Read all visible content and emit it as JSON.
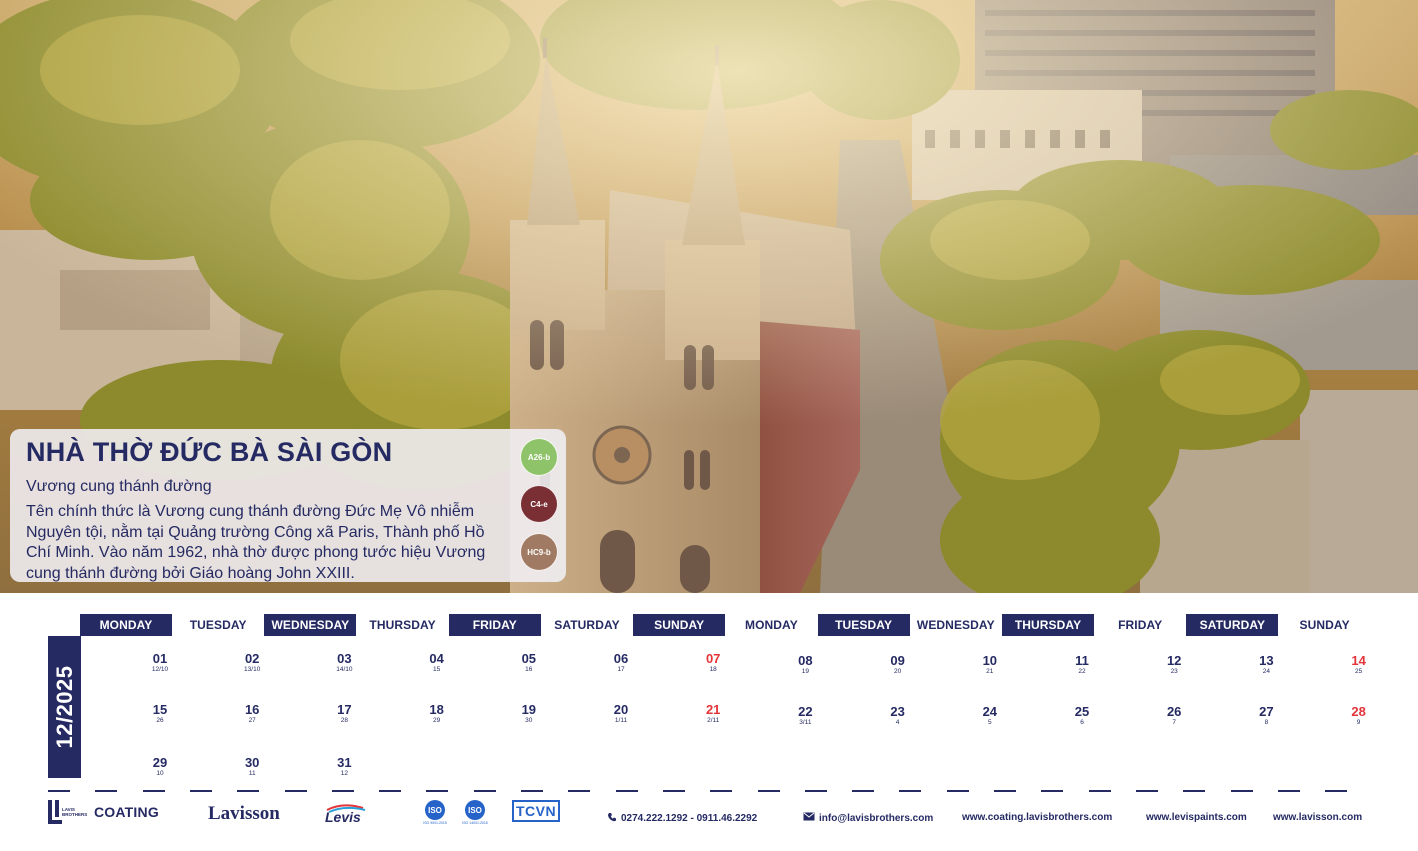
{
  "card": {
    "title": "NHÀ THỜ ĐỨC BÀ SÀI GÒN",
    "subtitle": "Vương cung thánh đường",
    "body": "Tên chính thức là Vương cung thánh đường Đức Mẹ Vô nhiễm Nguyên tội, nằm tại Quảng trường Công xã Paris, Thành phố Hồ Chí Minh. Vào năm 1962, nhà thờ được phong tước hiệu Vương cung thánh đường bởi Giáo hoàng John XXIII.",
    "swatches": [
      {
        "code": "A26-b",
        "color": "#8fc36a"
      },
      {
        "code": "C4-e",
        "color": "#7a2f35"
      },
      {
        "code": "HC9-b",
        "color": "#a07a62"
      }
    ]
  },
  "calendar": {
    "month_label": "12/2025",
    "weekday_headers": [
      "MONDAY",
      "TUESDAY",
      "WEDNESDAY",
      "THURSDAY",
      "FRIDAY",
      "SATURDAY",
      "SUNDAY",
      "MONDAY",
      "TUESDAY",
      "WEDNESDAY",
      "THURSDAY",
      "FRIDAY",
      "SATURDAY",
      "SUNDAY"
    ],
    "dates": [
      {
        "day": "01",
        "lunar": "12/10",
        "col": 0,
        "row": 0,
        "sunday": false
      },
      {
        "day": "02",
        "lunar": "13/10",
        "col": 1,
        "row": 0,
        "sunday": false
      },
      {
        "day": "03",
        "lunar": "14/10",
        "col": 2,
        "row": 0,
        "sunday": false
      },
      {
        "day": "04",
        "lunar": "15",
        "col": 3,
        "row": 0,
        "sunday": false
      },
      {
        "day": "05",
        "lunar": "16",
        "col": 4,
        "row": 0,
        "sunday": false
      },
      {
        "day": "06",
        "lunar": "17",
        "col": 5,
        "row": 0,
        "sunday": false
      },
      {
        "day": "07",
        "lunar": "18",
        "col": 6,
        "row": 0,
        "sunday": true
      },
      {
        "day": "08",
        "lunar": "19",
        "col": 7,
        "row": 0,
        "sunday": false
      },
      {
        "day": "09",
        "lunar": "20",
        "col": 8,
        "row": 0,
        "sunday": false
      },
      {
        "day": "10",
        "lunar": "21",
        "col": 9,
        "row": 0,
        "sunday": false
      },
      {
        "day": "11",
        "lunar": "22",
        "col": 10,
        "row": 0,
        "sunday": false
      },
      {
        "day": "12",
        "lunar": "23",
        "col": 11,
        "row": 0,
        "sunday": false
      },
      {
        "day": "13",
        "lunar": "24",
        "col": 12,
        "row": 0,
        "sunday": false
      },
      {
        "day": "14",
        "lunar": "25",
        "col": 13,
        "row": 0,
        "sunday": true
      },
      {
        "day": "15",
        "lunar": "26",
        "col": 0,
        "row": 1,
        "sunday": false
      },
      {
        "day": "16",
        "lunar": "27",
        "col": 1,
        "row": 1,
        "sunday": false
      },
      {
        "day": "17",
        "lunar": "28",
        "col": 2,
        "row": 1,
        "sunday": false
      },
      {
        "day": "18",
        "lunar": "29",
        "col": 3,
        "row": 1,
        "sunday": false
      },
      {
        "day": "19",
        "lunar": "30",
        "col": 4,
        "row": 1,
        "sunday": false
      },
      {
        "day": "20",
        "lunar": "1/11",
        "col": 5,
        "row": 1,
        "sunday": false
      },
      {
        "day": "21",
        "lunar": "2/11",
        "col": 6,
        "row": 1,
        "sunday": true
      },
      {
        "day": "22",
        "lunar": "3/11",
        "col": 7,
        "row": 1,
        "sunday": false
      },
      {
        "day": "23",
        "lunar": "4",
        "col": 8,
        "row": 1,
        "sunday": false
      },
      {
        "day": "24",
        "lunar": "5",
        "col": 9,
        "row": 1,
        "sunday": false
      },
      {
        "day": "25",
        "lunar": "6",
        "col": 10,
        "row": 1,
        "sunday": false
      },
      {
        "day": "26",
        "lunar": "7",
        "col": 11,
        "row": 1,
        "sunday": false
      },
      {
        "day": "27",
        "lunar": "8",
        "col": 12,
        "row": 1,
        "sunday": false
      },
      {
        "day": "28",
        "lunar": "9",
        "col": 13,
        "row": 1,
        "sunday": true
      },
      {
        "day": "29",
        "lunar": "10",
        "col": 0,
        "row": 2,
        "sunday": false
      },
      {
        "day": "30",
        "lunar": "11",
        "col": 1,
        "row": 2,
        "sunday": false
      },
      {
        "day": "31",
        "lunar": "12",
        "col": 2,
        "row": 2,
        "sunday": false
      }
    ]
  },
  "footer": {
    "coating_mark": "LAVIS BROTHERS",
    "coating_label": "COATING",
    "lavisson_logo": "Lavisson",
    "levis_logo": "Levis",
    "iso_badge_1": "ISO 9001:2015",
    "iso_badge_2": "ISO 14001:2015",
    "tcvn_label": "TCVN",
    "phone": "0274.222.1292 - 0911.46.2292",
    "email": "info@lavisbrothers.com",
    "site_1": "www.coating.lavisbrothers.com",
    "site_2": "www.levispaints.com",
    "site_3": "www.lavisson.com",
    "icons": [
      "phone-icon",
      "mail-icon"
    ],
    "brand_color": "#252a63",
    "sunday_color": "#e3343a"
  }
}
